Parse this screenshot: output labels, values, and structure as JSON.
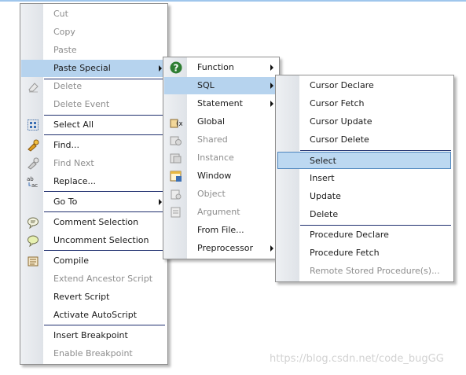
{
  "main_menu": {
    "items": [
      {
        "label": "Cut"
      },
      {
        "label": "Copy"
      },
      {
        "label": "Paste"
      },
      {
        "label": "Paste Special"
      },
      {
        "label": "Delete"
      },
      {
        "label": "Delete Event"
      },
      {
        "label": "Select All"
      },
      {
        "label": "Find..."
      },
      {
        "label": "Find Next"
      },
      {
        "label": "Replace..."
      },
      {
        "label": "Go To"
      },
      {
        "label": "Comment Selection"
      },
      {
        "label": "Uncomment Selection"
      },
      {
        "label": "Compile"
      },
      {
        "label": "Extend Ancestor Script"
      },
      {
        "label": "Revert Script"
      },
      {
        "label": "Activate AutoScript"
      },
      {
        "label": "Insert Breakpoint"
      },
      {
        "label": "Enable Breakpoint"
      }
    ]
  },
  "paste_special_menu": {
    "items": [
      {
        "label": "Function"
      },
      {
        "label": "SQL"
      },
      {
        "label": "Statement"
      },
      {
        "label": "Global"
      },
      {
        "label": "Shared"
      },
      {
        "label": "Instance"
      },
      {
        "label": "Window"
      },
      {
        "label": "Object"
      },
      {
        "label": "Argument"
      },
      {
        "label": "From File..."
      },
      {
        "label": "Preprocessor"
      }
    ]
  },
  "sql_menu": {
    "items": [
      {
        "label": "Cursor Declare"
      },
      {
        "label": "Cursor Fetch"
      },
      {
        "label": "Cursor Update"
      },
      {
        "label": "Cursor Delete"
      },
      {
        "label": "Select"
      },
      {
        "label": "Insert"
      },
      {
        "label": "Update"
      },
      {
        "label": "Delete"
      },
      {
        "label": "Procedure Declare"
      },
      {
        "label": "Procedure Fetch"
      },
      {
        "label": "Remote Stored Procedure(s)..."
      }
    ]
  },
  "watermark": "https://blog.csdn.net/code_bugGG",
  "colors": {
    "highlight": "#b6d3ee",
    "highlight_border": "#4f86bd",
    "separator": "#1f2f6e",
    "disabled_text": "#8d8d8d"
  }
}
